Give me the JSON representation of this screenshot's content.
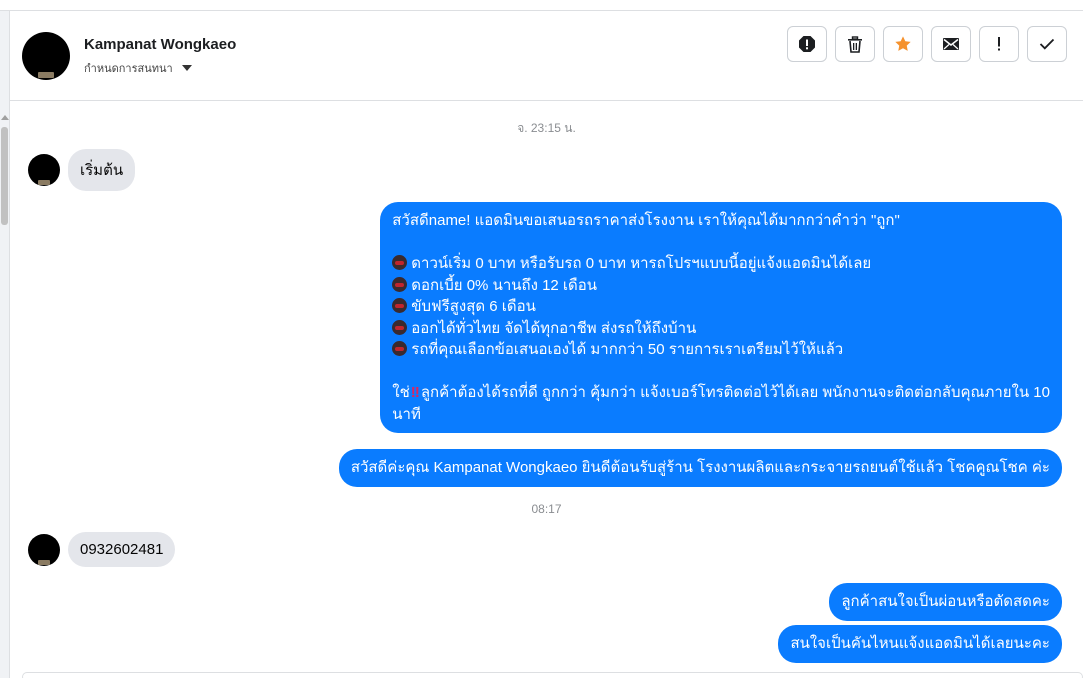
{
  "header": {
    "contact_name": "Kampanat Wongkaeo",
    "assign_label": "กำหนดการสนทนา",
    "actions": [
      {
        "name": "report-icon"
      },
      {
        "name": "trash-icon"
      },
      {
        "name": "star-icon",
        "color": "#f5922e"
      },
      {
        "name": "mail-icon"
      },
      {
        "name": "exclamation-icon"
      },
      {
        "name": "check-icon"
      }
    ]
  },
  "chat": {
    "timestamp_1": "จ. 23:15 น.",
    "msg_in_1": "เริ่มต้น",
    "msg_out_1": {
      "line_1": "สวัสดีname! แอดมินขอเสนอรถราคาส่งโรงงาน เราให้คุณได้มากกว่าคำว่า \"ถูก\"",
      "bullets": [
        "ดาวน์เริ่ม 0 บาท หรือรับรถ 0 บาท หารถโปรฯแบบนี้อยู่แจ้งแอดมินได้เลย",
        "ดอกเบี้ย 0% นานถึง 12 เดือน",
        "ขับฟรีสูงสุด 6 เดือน",
        "ออกได้ทั่วไทย จัดได้ทุกอาชีพ ส่งรถให้ถึงบ้าน",
        "รถที่คุณเลือกข้อเสนอเองได้ มากกว่า 50 รายการเราเตรียมไว้ให้แล้ว"
      ],
      "closing_prefix": "ใช่",
      "closing_emoji": "‼",
      "closing_line_1": "ลูกค้าต้องได้รถที่ดี ถูกกว่า คุ้มกว่า แจ้งเบอร์โทรติดต่อไว้ได้เลย พนักงานจะติดต่อกลับคุณภายใน 10",
      "closing_line_2": "นาที"
    },
    "msg_out_2": "สวัสดีค่ะคุณ Kampanat Wongkaeo ยินดีต้อนรับสู่ร้าน โรงงานผลิตและกระจายรถยนต์ใช้แล้ว โชคคูณโชค ค่ะ",
    "timestamp_2": "08:17",
    "msg_in_2": "0932602481",
    "msg_out_3": "ลูกค้าสนใจเป็นผ่อนหรือตัดสดคะ",
    "msg_out_4": "สนใจเป็นคันไหนแจ้งแอดมินได้เลยนะคะ"
  },
  "colors": {
    "outgoing_bubble": "#0a7cff",
    "incoming_bubble": "#e4e6eb",
    "star": "#f5922e"
  }
}
